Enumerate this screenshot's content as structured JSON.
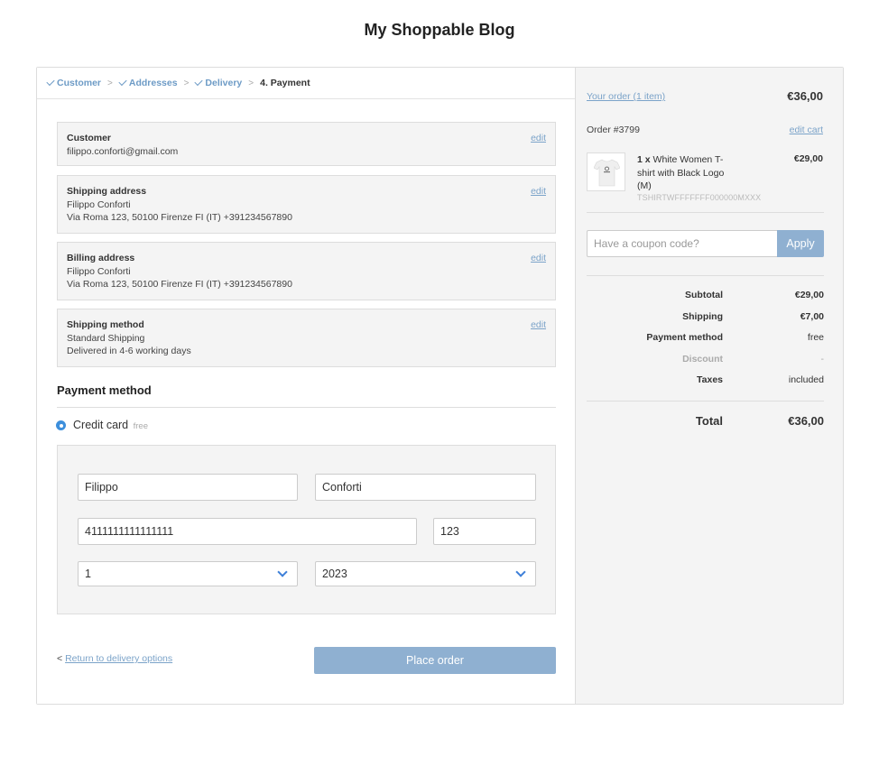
{
  "site": {
    "title": "My Shoppable Blog"
  },
  "breadcrumb": {
    "steps": [
      {
        "label": "Customer",
        "done": true
      },
      {
        "label": "Addresses",
        "done": true
      },
      {
        "label": "Delivery",
        "done": true
      },
      {
        "label": "4. Payment",
        "done": false
      }
    ],
    "separator": ">"
  },
  "review": {
    "edit_label": "edit",
    "customer": {
      "title": "Customer",
      "lines": [
        "filippo.conforti@gmail.com"
      ]
    },
    "shipping_address": {
      "title": "Shipping address",
      "lines": [
        "Filippo Conforti",
        "Via Roma 123, 50100 Firenze FI (IT) +391234567890"
      ]
    },
    "billing_address": {
      "title": "Billing address",
      "lines": [
        "Filippo Conforti",
        "Via Roma 123, 50100 Firenze FI (IT) +391234567890"
      ]
    },
    "shipping_method": {
      "title": "Shipping method",
      "lines": [
        "Standard Shipping",
        "Delivered in 4-6 working days"
      ]
    }
  },
  "payment": {
    "title": "Payment method",
    "option_label": "Credit card",
    "option_note": "free",
    "first_name": "Filippo",
    "last_name": "Conforti",
    "card_number": "4111111111111111",
    "cvv": "123",
    "exp_month": "1",
    "exp_year": "2023"
  },
  "footer": {
    "back_prefix": "<",
    "back_label": "Return to delivery options",
    "place_order_label": "Place order"
  },
  "summary": {
    "your_order_label": "Your order (1 item)",
    "total_top": "€36,00",
    "order_number": "Order #3799",
    "edit_cart_label": "edit cart",
    "item": {
      "qty": "1 x",
      "name": "White Women T-shirt with Black Logo (M)",
      "sku": "TSHIRTWFFFFFFF000000MXXX",
      "price": "€29,00"
    },
    "coupon_placeholder": "Have a coupon code?",
    "apply_label": "Apply",
    "rows": [
      {
        "label": "Subtotal",
        "value": "€29,00"
      },
      {
        "label": "Shipping",
        "value": "€7,00"
      },
      {
        "label": "Payment method",
        "value": "free"
      },
      {
        "label": "Discount",
        "value": "-"
      },
      {
        "label": "Taxes",
        "value": "included"
      }
    ],
    "total_label": "Total",
    "total_value": "€36,00"
  },
  "colors": {
    "accent": "#7ba3c9",
    "button": "#8fb0d1",
    "panel": "#f4f4f4",
    "radio": "#3d8fdc"
  }
}
